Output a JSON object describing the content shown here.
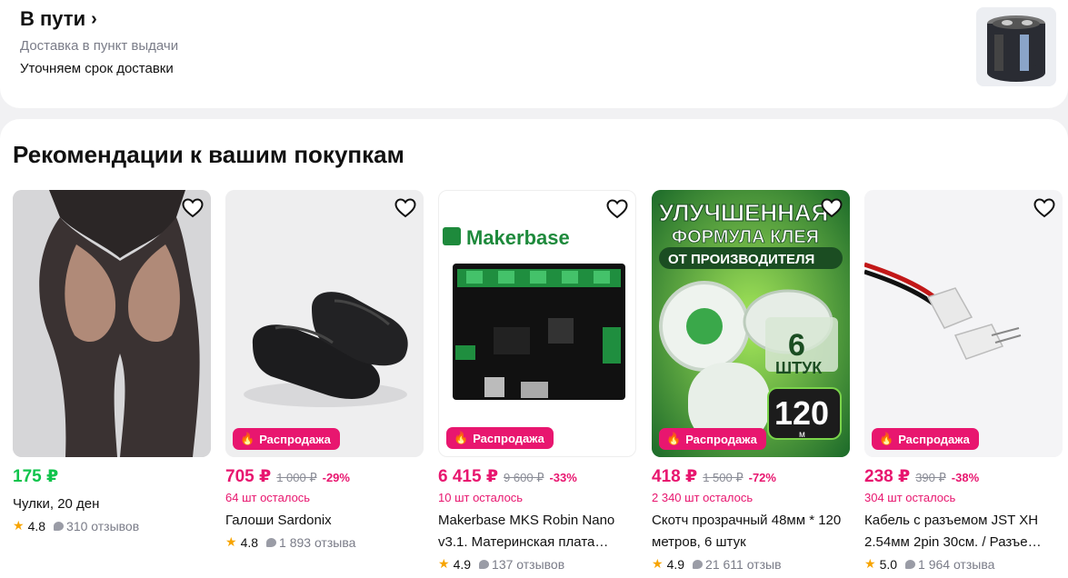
{
  "delivery": {
    "title": "В пути",
    "chevron": "›",
    "subtitle": "Доставка в пункт выдачи",
    "note": "Уточняем срок доставки"
  },
  "recommendations": {
    "title": "Рекомендации к вашим покупкам",
    "sale_label": "Распродажа",
    "products": [
      {
        "price": "175 ₽",
        "old_price": "",
        "discount": "",
        "stock": "",
        "name": "Чулки, 20 ден",
        "rating": "4.8",
        "reviews": "310 отзывов",
        "sale": false
      },
      {
        "price": "705 ₽",
        "old_price": "1 000 ₽",
        "discount": "-29%",
        "stock": "64 шт осталось",
        "name": "Галоши Sardonix",
        "rating": "4.8",
        "reviews": "1 893 отзыва",
        "sale": true
      },
      {
        "price": "6 415 ₽",
        "old_price": "9 600 ₽",
        "discount": "-33%",
        "stock": "10 шт осталось",
        "name": "Makerbase MKS Robin Nano v3.1. Материнская плата…",
        "rating": "4.9",
        "reviews": "137 отзывов",
        "sale": true
      },
      {
        "price": "418 ₽",
        "old_price": "1 500 ₽",
        "discount": "-72%",
        "stock": "2 340 шт осталось",
        "name": "Скотч прозрачный 48мм * 120 метров, 6 штук",
        "rating": "4.9",
        "reviews": "21 611 отзыв",
        "sale": true
      },
      {
        "price": "238 ₽",
        "old_price": "390 ₽",
        "discount": "-38%",
        "stock": "304 шт осталось",
        "name": "Кабель с разъемом JST XH 2.54мм 2pin 30см. / Разъе…",
        "rating": "5.0",
        "reviews": "1 964 отзыва",
        "sale": true
      }
    ],
    "image_text": {
      "makerbase_logo": "Makerbase",
      "tape_line1": "УЛУЧШЕННАЯ",
      "tape_line2": "ФОРМУЛА КЛЕЯ",
      "tape_line3": "ОТ ПРОИЗВОДИТЕЛЯ",
      "tape_count": "6",
      "tape_unit": "ШТУК",
      "tape_length": "120",
      "tape_length_unit": "м"
    }
  },
  "colors": {
    "accent": "#e8166f",
    "price_green": "#10c44c",
    "star": "#f7a400"
  }
}
